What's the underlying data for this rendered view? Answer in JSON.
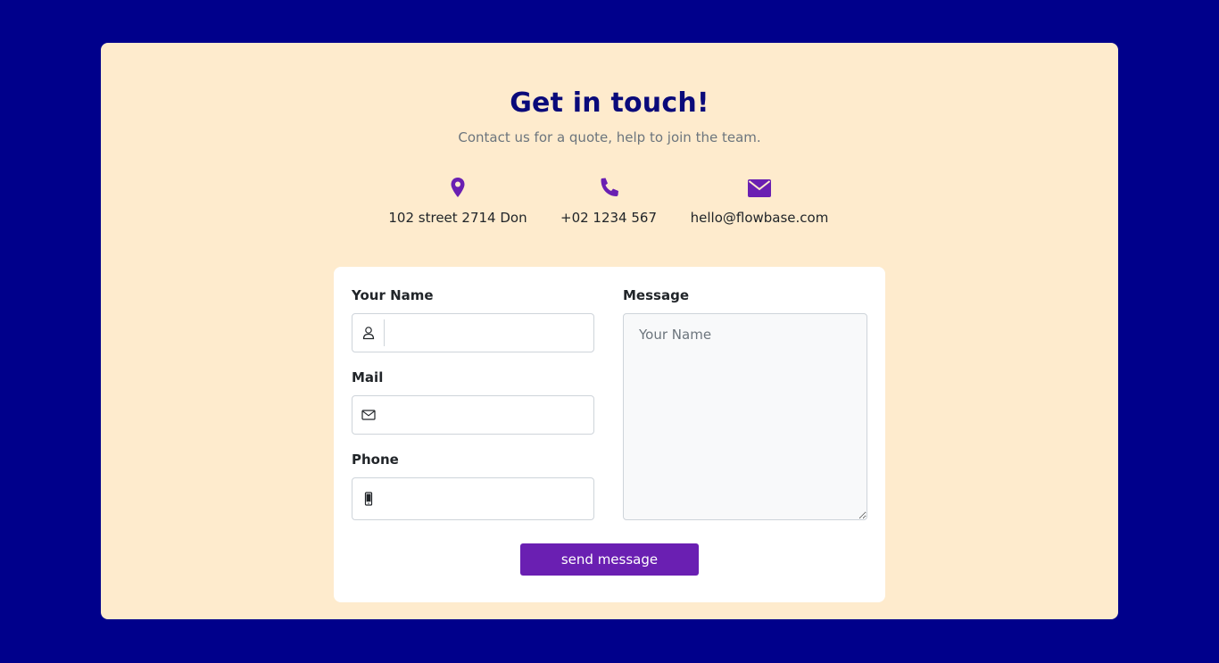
{
  "header": {
    "title": "Get in touch!",
    "subtitle": "Contact us for a quote, help to join the team."
  },
  "contacts": [
    {
      "icon": "map-pin-icon",
      "text": "102 street 2714 Don"
    },
    {
      "icon": "phone-icon",
      "text": "+02 1234 567"
    },
    {
      "icon": "envelope-icon",
      "text": "hello@flowbase.com"
    }
  ],
  "form": {
    "name_label": "Your Name",
    "name_value": "",
    "mail_label": "Mail",
    "mail_value": "",
    "phone_label": "Phone",
    "phone_value": "",
    "message_label": "Message",
    "message_placeholder": "Your Name",
    "message_value": "",
    "submit_label": "send message"
  },
  "colors": {
    "page_background": "#00008b",
    "panel_background": "#feebcd",
    "title": "#0a0a7a",
    "accent": "#6a1fb2",
    "card_background": "#ffffff"
  }
}
